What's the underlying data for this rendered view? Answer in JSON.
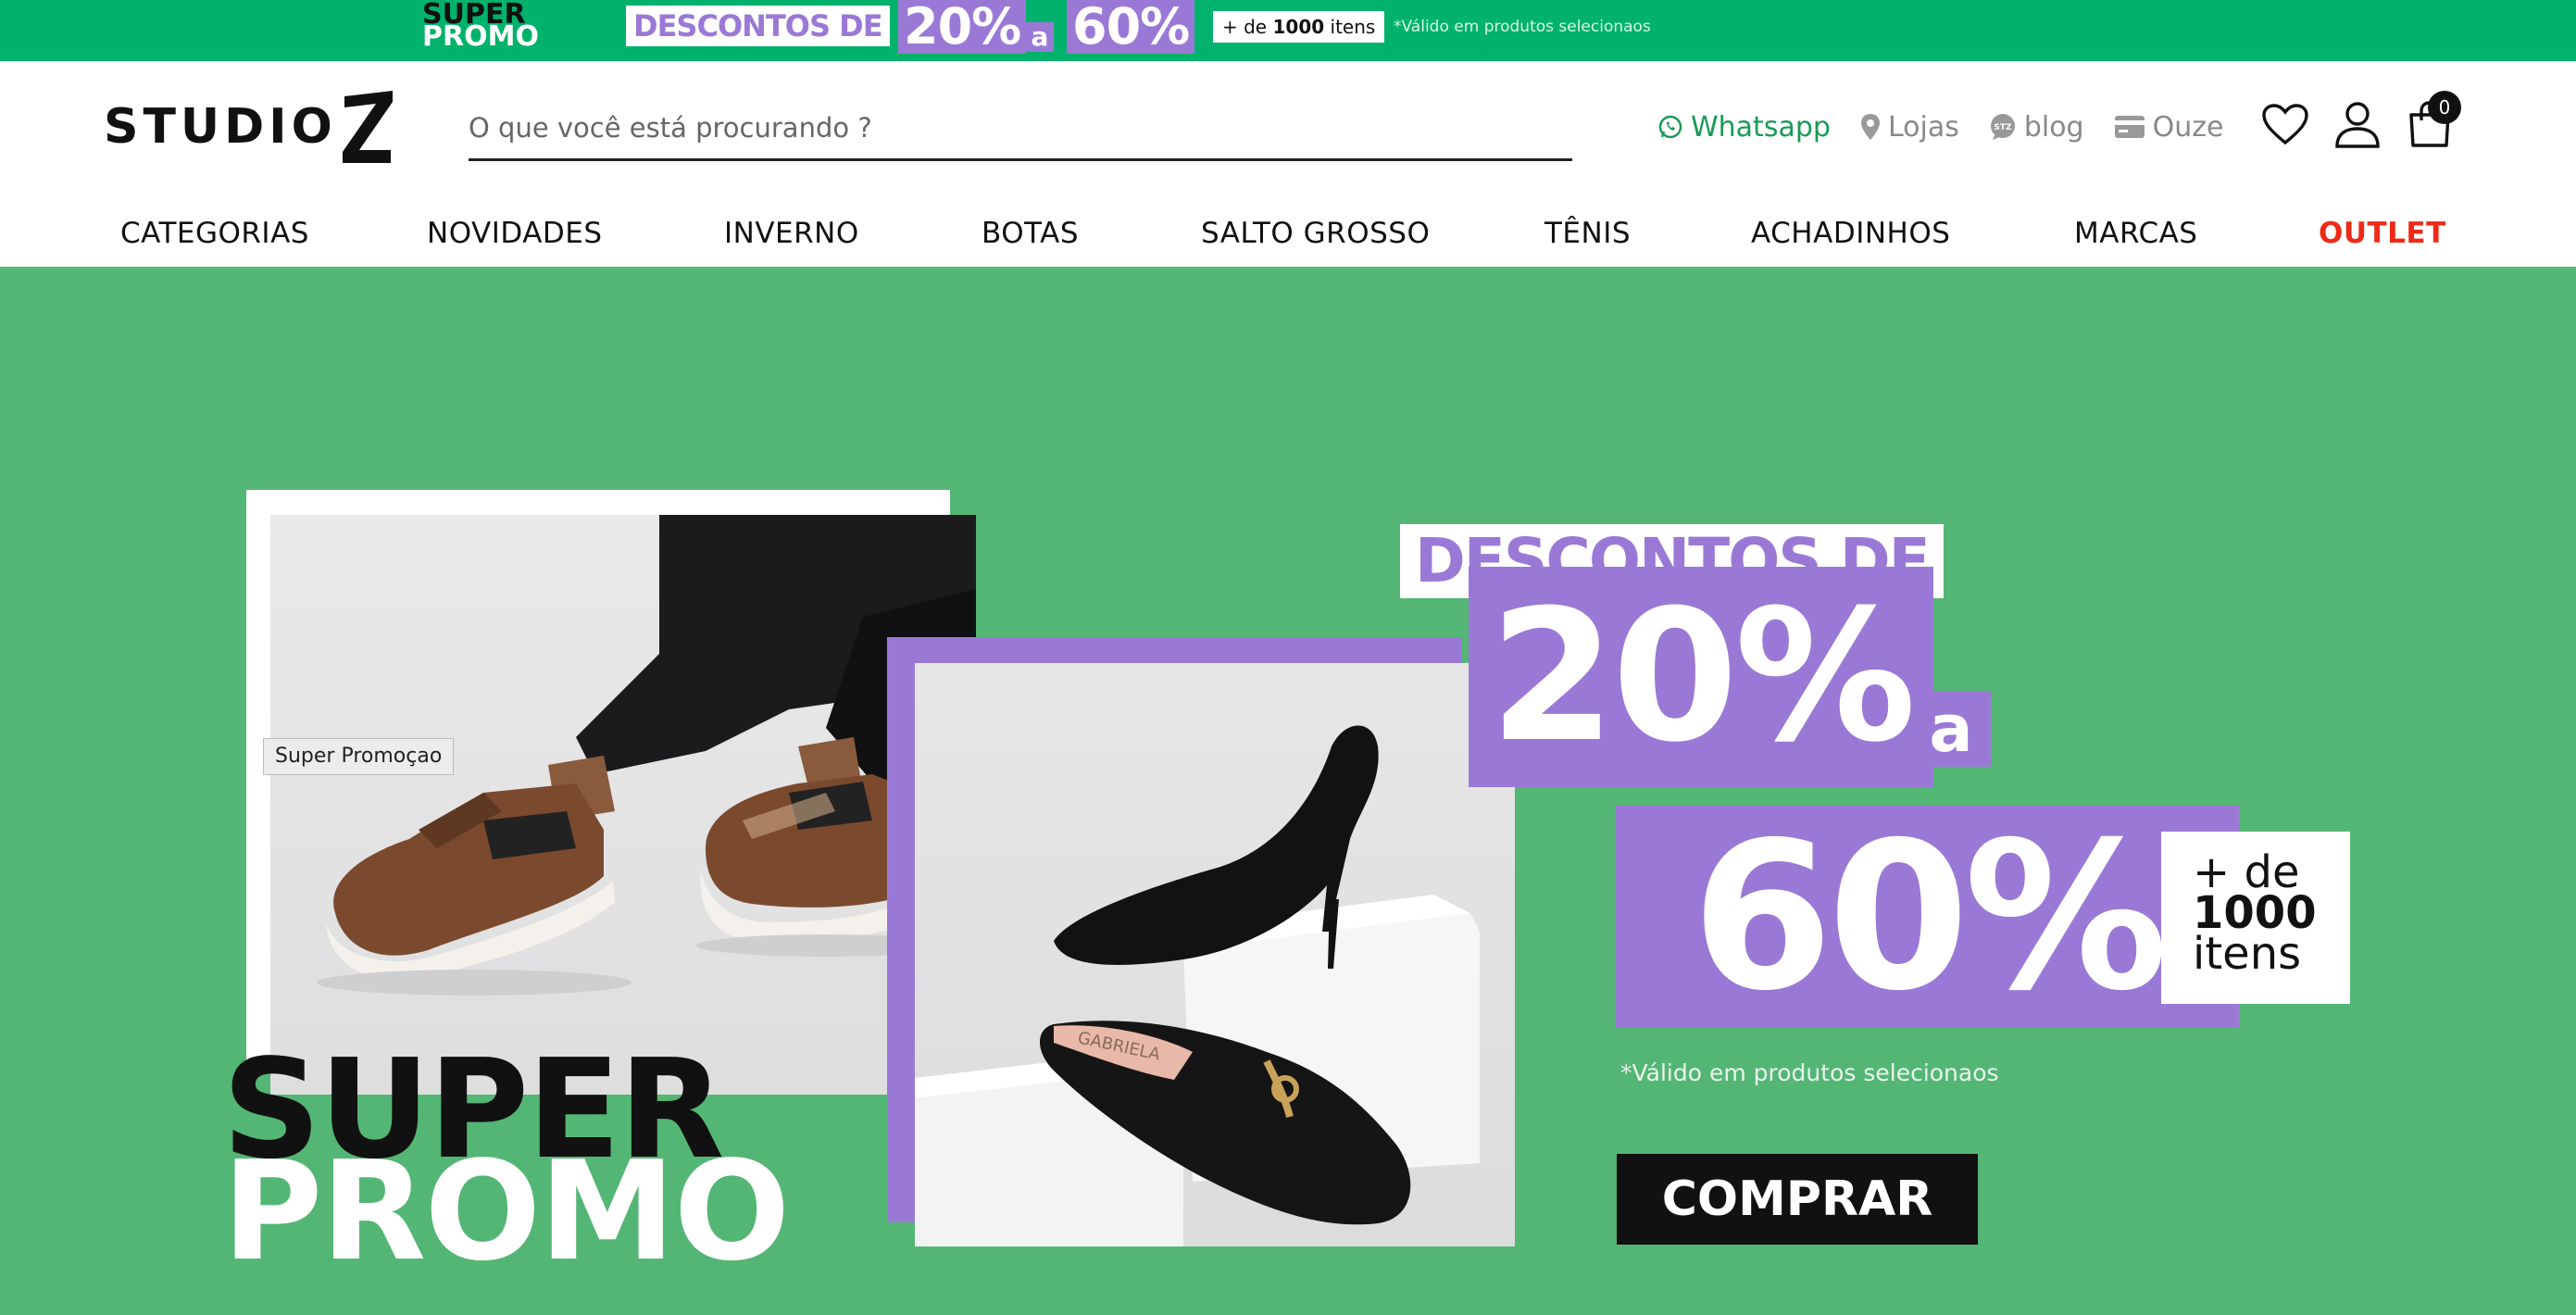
{
  "promo_strip": {
    "super": "SUPER",
    "promo": "PROMO",
    "descontos": "DESCONTOS DE",
    "pct_from": "20%",
    "connector": "a",
    "pct_to": "60%",
    "items_prefix": "+ de",
    "items_count": "1000",
    "items_suffix": "itens",
    "validity": "*Válido em produtos selecionaos"
  },
  "header": {
    "logo_text": "STUDIO",
    "search_placeholder": "O que você está procurando ?",
    "links": {
      "whatsapp": "Whatsapp",
      "stores": "Lojas",
      "blog": "blog",
      "ouze": "Ouze"
    },
    "cart_count": "0"
  },
  "nav": {
    "categorias": "CATEGORIAS",
    "novidades": "NOVIDADES",
    "inverno": "INVERNO",
    "botas": "BOTAS",
    "salto_grosso": "SALTO GROSSO",
    "tenis": "TÊNIS",
    "achadinhos": "ACHADINHOS",
    "marcas": "MARCAS",
    "outlet": "OUTLET"
  },
  "hero": {
    "tag": "Super Promoçao",
    "super": "SUPER",
    "promo": "PROMO",
    "descontos": "DESCONTOS DE",
    "pct_from": "20%",
    "connector": "a",
    "pct_to": "60%",
    "items_prefix": "+ de",
    "items_count": "1000",
    "items_suffix": "itens",
    "validity": "*Válido em produtos selecionaos",
    "cta": "COMPRAR"
  },
  "colors": {
    "strip_green": "#00b26b",
    "hero_green": "#54b674",
    "purple": "#9a79d6",
    "whatsapp_green": "#1a9a55",
    "outlet_red": "#ee2a17"
  }
}
